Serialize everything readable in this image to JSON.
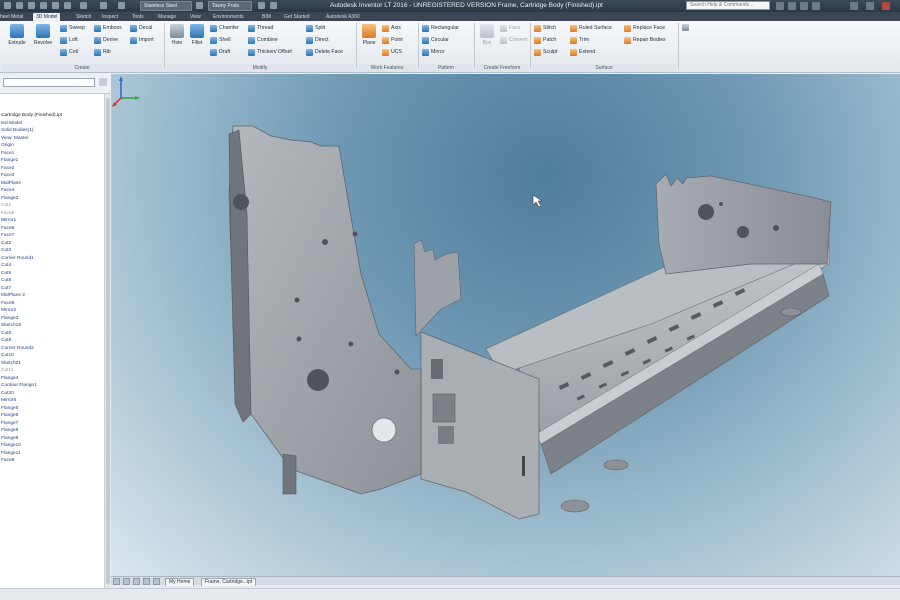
{
  "titlebar": {
    "material": "Stainless Steel",
    "appearance": "Tawny Pods",
    "title": "Autodesk Inventor LT 2016 - UNREGISTERED VERSION   Frame, Cartridge Body (Finished).ipt",
    "search_placeholder": "Search Help & Commands..."
  },
  "tabs": [
    "heet Metal",
    "3D Model",
    "Sketch",
    "Inspect",
    "Tools",
    "Manage",
    "View",
    "Environments",
    "BIM",
    "Get Started",
    "Autodesk A360"
  ],
  "ribbon": {
    "extrude": "Extrude",
    "revolve": "Revolve",
    "sweep": "Sweep",
    "emboss": "Emboss",
    "decal": "Decal",
    "loft": "Loft",
    "derive": "Derive",
    "import": "Import",
    "coil": "Coil",
    "rib": "Rib",
    "create_title": "Create",
    "hole": "Hole",
    "fillet": "Fillet",
    "chamfer": "Chamfer",
    "thread": "Thread",
    "split": "Split",
    "shell": "Shell",
    "combine": "Combine",
    "direct": "Direct",
    "draft": "Draft",
    "thicken": "Thicken/ Offset",
    "delete_face": "Delete Face",
    "modify_title": "Modify",
    "plane": "Plane",
    "axis": "Axis",
    "point": "Point",
    "ucs": "UCS",
    "work_title": "Work Features",
    "rectangular": "Rectangular",
    "circular": "Circular",
    "mirror": "Mirror",
    "pattern_title": "Pattern",
    "box": "Box",
    "convert": "Convert",
    "face": "Face",
    "freeform_title": "Create Freeform",
    "stitch": "Stitch",
    "ruled_surface": "Ruled Surface",
    "replace_face": "Replace Face",
    "patch": "Patch",
    "trim": "Trim",
    "repair_bodies": "Repair Bodies",
    "sculpt": "Sculpt",
    "extend": "Extend",
    "surface_title": "Surface"
  },
  "browser": {
    "items": [
      {
        "label": "Cartridge Body (Finished).ipt",
        "grey": false
      },
      {
        "label": "ted Model",
        "grey": false
      },
      {
        "label": "Solid Bodies(1)",
        "grey": false
      },
      {
        "label": "View: Master",
        "grey": false
      },
      {
        "label": "Origin",
        "grey": false
      },
      {
        "label": "Face1",
        "grey": false
      },
      {
        "label": "Flange1",
        "grey": false
      },
      {
        "label": "Face2",
        "grey": false
      },
      {
        "label": "Face3",
        "grey": false
      },
      {
        "label": "MidPlane",
        "grey": false
      },
      {
        "label": "Face4",
        "grey": false
      },
      {
        "label": "Flange2",
        "grey": false
      },
      {
        "label": "Cut1",
        "grey": true
      },
      {
        "label": "Face5",
        "grey": true
      },
      {
        "label": "Mirror1",
        "grey": false
      },
      {
        "label": "Face6",
        "grey": false
      },
      {
        "label": "Face7",
        "grey": false
      },
      {
        "label": "Cut2",
        "grey": false
      },
      {
        "label": "Cut3",
        "grey": false
      },
      {
        "label": "Corner Round1",
        "grey": false
      },
      {
        "label": "Cut4",
        "grey": false
      },
      {
        "label": "Cut5",
        "grey": false
      },
      {
        "label": "Cut6",
        "grey": false
      },
      {
        "label": "Cut7",
        "grey": false
      },
      {
        "label": "MidPlane 2",
        "grey": false
      },
      {
        "label": "Face8",
        "grey": false
      },
      {
        "label": "Mirror2",
        "grey": false
      },
      {
        "label": "Flange3",
        "grey": false
      },
      {
        "label": "Sketch18",
        "grey": false
      },
      {
        "label": "Cut8",
        "grey": false
      },
      {
        "label": "Cut9",
        "grey": false
      },
      {
        "label": "Corner Round2",
        "grey": false
      },
      {
        "label": "Cut10",
        "grey": false
      },
      {
        "label": "Sketch21",
        "grey": false
      },
      {
        "label": "Cut11",
        "grey": true
      },
      {
        "label": "Flange4",
        "grey": false
      },
      {
        "label": "Contour Flange1",
        "grey": false
      },
      {
        "label": "Cut20",
        "grey": false
      },
      {
        "label": "Mirror6",
        "grey": false
      },
      {
        "label": "Flange5",
        "grey": false
      },
      {
        "label": "Flange6",
        "grey": false
      },
      {
        "label": "Flange7",
        "grey": false
      },
      {
        "label": "Flange8",
        "grey": false
      },
      {
        "label": "Flange9",
        "grey": false
      },
      {
        "label": "Flange10",
        "grey": false
      },
      {
        "label": "Flange11",
        "grey": false
      },
      {
        "label": "Face9",
        "grey": false
      }
    ]
  },
  "doctabs": {
    "home": "My Home",
    "document": "Frame, Cartridge...ipt"
  },
  "colors": {
    "viewport_top": "#4f7d9c",
    "viewport_bottom": "#dbe6ec",
    "part_metal": "#9ea4aa"
  }
}
